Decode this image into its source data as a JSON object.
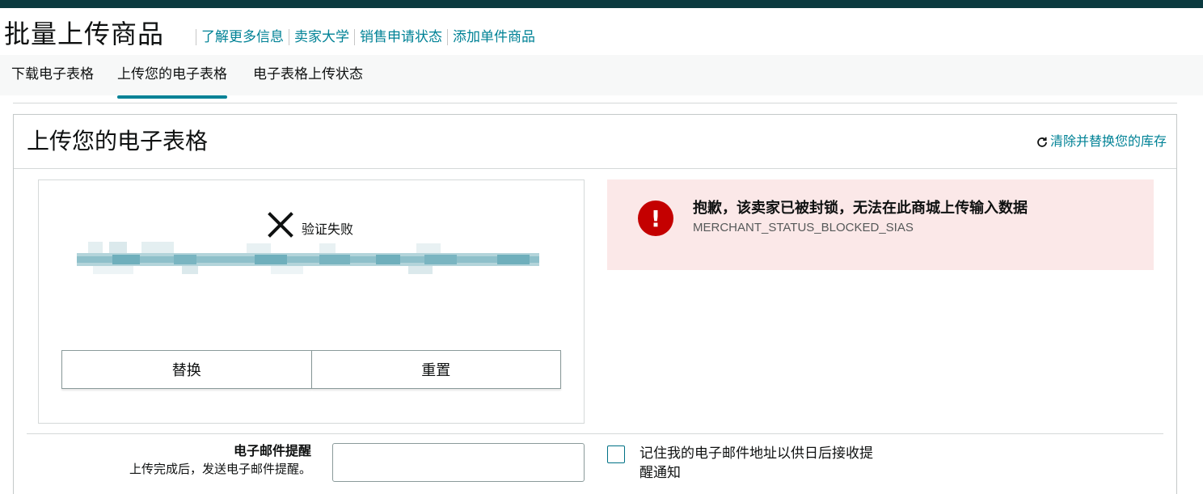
{
  "header": {
    "title": "批量上传商品",
    "links": [
      "了解更多信息",
      "卖家大学",
      "销售申请状态",
      "添加单件商品"
    ]
  },
  "tabs": [
    {
      "label": "下载电子表格",
      "active": false
    },
    {
      "label": "上传您的电子表格",
      "active": true
    },
    {
      "label": "电子表格上传状态",
      "active": false
    }
  ],
  "card": {
    "title": "上传您的电子表格",
    "clear_link": "清除并替换您的库存",
    "upload": {
      "status_text": "验证失败",
      "replace_label": "替换",
      "reset_label": "重置"
    },
    "error": {
      "title": "抱歉，该卖家已被封锁，无法在此商城上传输入数据",
      "code": "MERCHANT_STATUS_BLOCKED_SIAS"
    },
    "email": {
      "label": "电子邮件提醒",
      "hint": "上传完成后，发送电子邮件提醒。",
      "value": "",
      "remember_label": "记住我的电子邮件地址以供日后接收提醒通知",
      "remember_checked": false
    }
  },
  "colors": {
    "topbar": "#0b3a3f",
    "link": "#008296",
    "error_bg": "#fbe8e8",
    "error_icon": "#c40000"
  },
  "icons": [
    "refresh-icon",
    "close-x-icon",
    "alert-icon"
  ]
}
